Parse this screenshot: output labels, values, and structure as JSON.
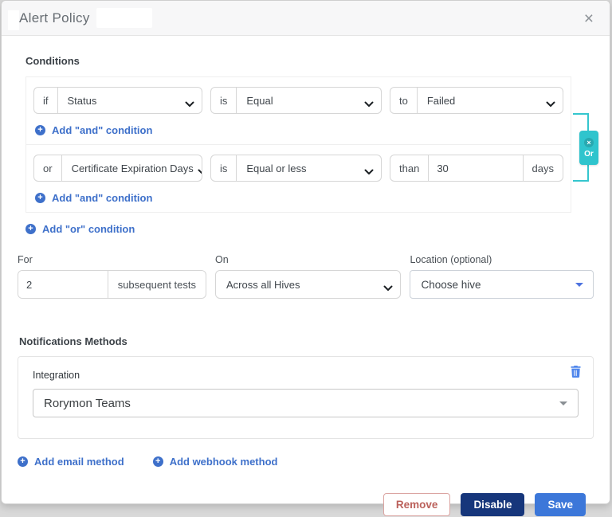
{
  "modal": {
    "title": "Alert Policy",
    "close_glyph": "×"
  },
  "conditions": {
    "section_label": "Conditions",
    "cond1": {
      "prefix": "if",
      "field": "Status",
      "is_label": "is",
      "operator": "Equal",
      "to_label": "to",
      "value": "Failed"
    },
    "cond2": {
      "prefix": "or",
      "field": "Certificate Expiration Days",
      "is_label": "is",
      "operator": "Equal or less",
      "to_label": "than",
      "value": "30",
      "unit": "days"
    },
    "or_badge": {
      "label": "Or",
      "remove_glyph": "×"
    },
    "links": {
      "add_and": "Add \"and\" condition",
      "add_or": "Add \"or\" condition"
    },
    "plus_glyph": "+"
  },
  "scope": {
    "for_label": "For",
    "for_value": "2",
    "for_suffix": "subsequent tests",
    "on_label": "On",
    "on_value": "Across all Hives",
    "location_label": "Location (optional)",
    "location_value": "Choose hive"
  },
  "notifications": {
    "section_label": "Notifications Methods",
    "integration_label": "Integration",
    "integration_value": "Rorymon Teams",
    "links": {
      "add_email": "Add email method",
      "add_webhook": "Add webhook method"
    }
  },
  "footer": {
    "remove": "Remove",
    "disable": "Disable",
    "save": "Save"
  },
  "colors": {
    "teal_accent": "#2fc4cd",
    "link_blue": "#3e70ca",
    "save_blue": "#3c77d9",
    "disable_navy": "#16367b",
    "remove_red": "#bb615b",
    "trash_blue": "#4f86ec",
    "header_bg": "#f7f7f8",
    "backdrop": "#d9d9d9"
  }
}
